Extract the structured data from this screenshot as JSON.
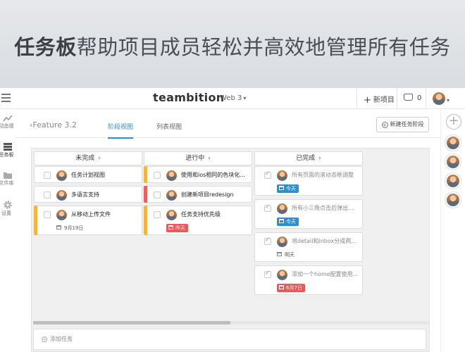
{
  "banner": {
    "title_bold": "任务板",
    "title_rest": "帮助项目成员轻松并高效地管理所有任务"
  },
  "topbar": {
    "logo": "teambition",
    "project": "Web 3",
    "new_project": "新项目",
    "inbox_count": "0"
  },
  "leftnav": {
    "items": [
      {
        "label": "动态墙",
        "icon": "activity-icon"
      },
      {
        "label": "任务板",
        "icon": "board-icon"
      },
      {
        "label": "文件库",
        "icon": "folder-icon"
      },
      {
        "label": "设置",
        "icon": "gear-icon"
      }
    ]
  },
  "subbar": {
    "back_label": "Feature 3.2",
    "tabs": [
      {
        "label": "阶段视图"
      },
      {
        "label": "列表视图"
      }
    ],
    "new_stage": "新建任务阶段"
  },
  "colors": {
    "accent": "#2b8fd6",
    "stripe_yellow": "#f2b544",
    "stripe_red": "#e86060",
    "badge_blue": "#2b8fd6",
    "badge_red": "#e8595a"
  },
  "columns": [
    {
      "name": "未完成",
      "cards": [
        {
          "title": "任务计划视图"
        },
        {
          "title": "多语言支持"
        },
        {
          "title": "从移动上传文件",
          "date": "9月19日",
          "stripe": "yellow"
        }
      ]
    },
    {
      "name": "进行中",
      "cards": [
        {
          "title": "使用和ios相同的色块化...",
          "stripe": "yellow"
        },
        {
          "title": "创建新项目redesign",
          "stripe": "red"
        },
        {
          "title": "任务支持优先级",
          "badge": "昨天",
          "stripe": "yellow"
        }
      ]
    },
    {
      "name": "已完成",
      "cards": [
        {
          "title": "所有页面的滚动态框调整",
          "badge": "今天"
        },
        {
          "title": "所有小三角点击后弹出...",
          "badge": "今天"
        },
        {
          "title": "将detail和inbox分成两...",
          "date": "明天"
        },
        {
          "title": "添加一个home配置使用...",
          "badge": "6月7日"
        }
      ]
    }
  ],
  "add_task": "添加任务"
}
